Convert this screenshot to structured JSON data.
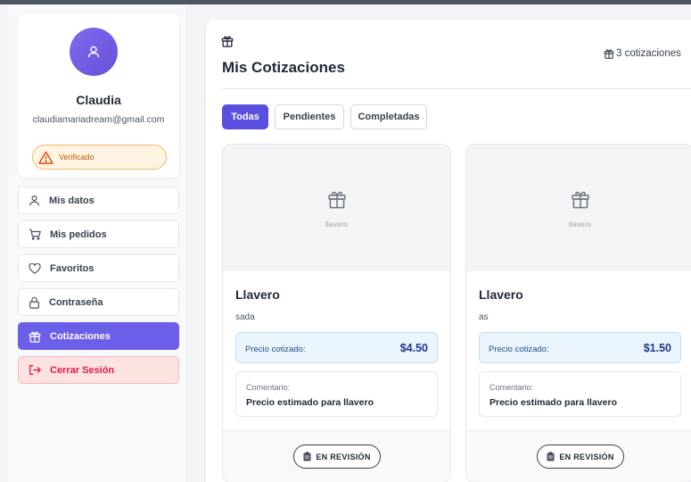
{
  "profile": {
    "name": "Claudia",
    "email": "claudiamariadream@gmail.com",
    "badge": "Verificado"
  },
  "sidebar": {
    "items": [
      {
        "label": "Mis datos",
        "icon": "user-icon"
      },
      {
        "label": "Mis pedidos",
        "icon": "cart-icon"
      },
      {
        "label": "Favoritos",
        "icon": "heart-icon"
      },
      {
        "label": "Contraseña",
        "icon": "lock-icon"
      },
      {
        "label": "Cotizaciones",
        "icon": "gift-icon",
        "active": true
      },
      {
        "label": "Cerrar Sesión",
        "icon": "logout-icon"
      }
    ]
  },
  "main": {
    "title": "Mis Cotizaciones",
    "count": "3 cotizaciones",
    "tabs": [
      {
        "label": "Todas",
        "active": true
      },
      {
        "label": "Pendientes"
      },
      {
        "label": "Completadas"
      }
    ]
  },
  "quotes": [
    {
      "image_label": "llavero",
      "title": "Llavero",
      "description": "sada",
      "price_label": "Precio cotizado:",
      "price": "$4.50",
      "comment_label": "Comentario:",
      "comment": "Precio estimado para llavero",
      "status": "EN REVISIÓN"
    },
    {
      "image_label": "llavero",
      "title": "Llavero",
      "description": "as",
      "price_label": "Precio cotizado:",
      "price": "$1.50",
      "comment_label": "Comentario:",
      "comment": "Precio estimado para llavero",
      "status": "EN REVISIÓN"
    }
  ],
  "colors": {
    "accent": "#6b5ee8",
    "logout_bg": "#fde2e2",
    "logout_text": "#e11d48",
    "badge_border": "#f5b86a",
    "price_bg": "#eaf5fd"
  }
}
